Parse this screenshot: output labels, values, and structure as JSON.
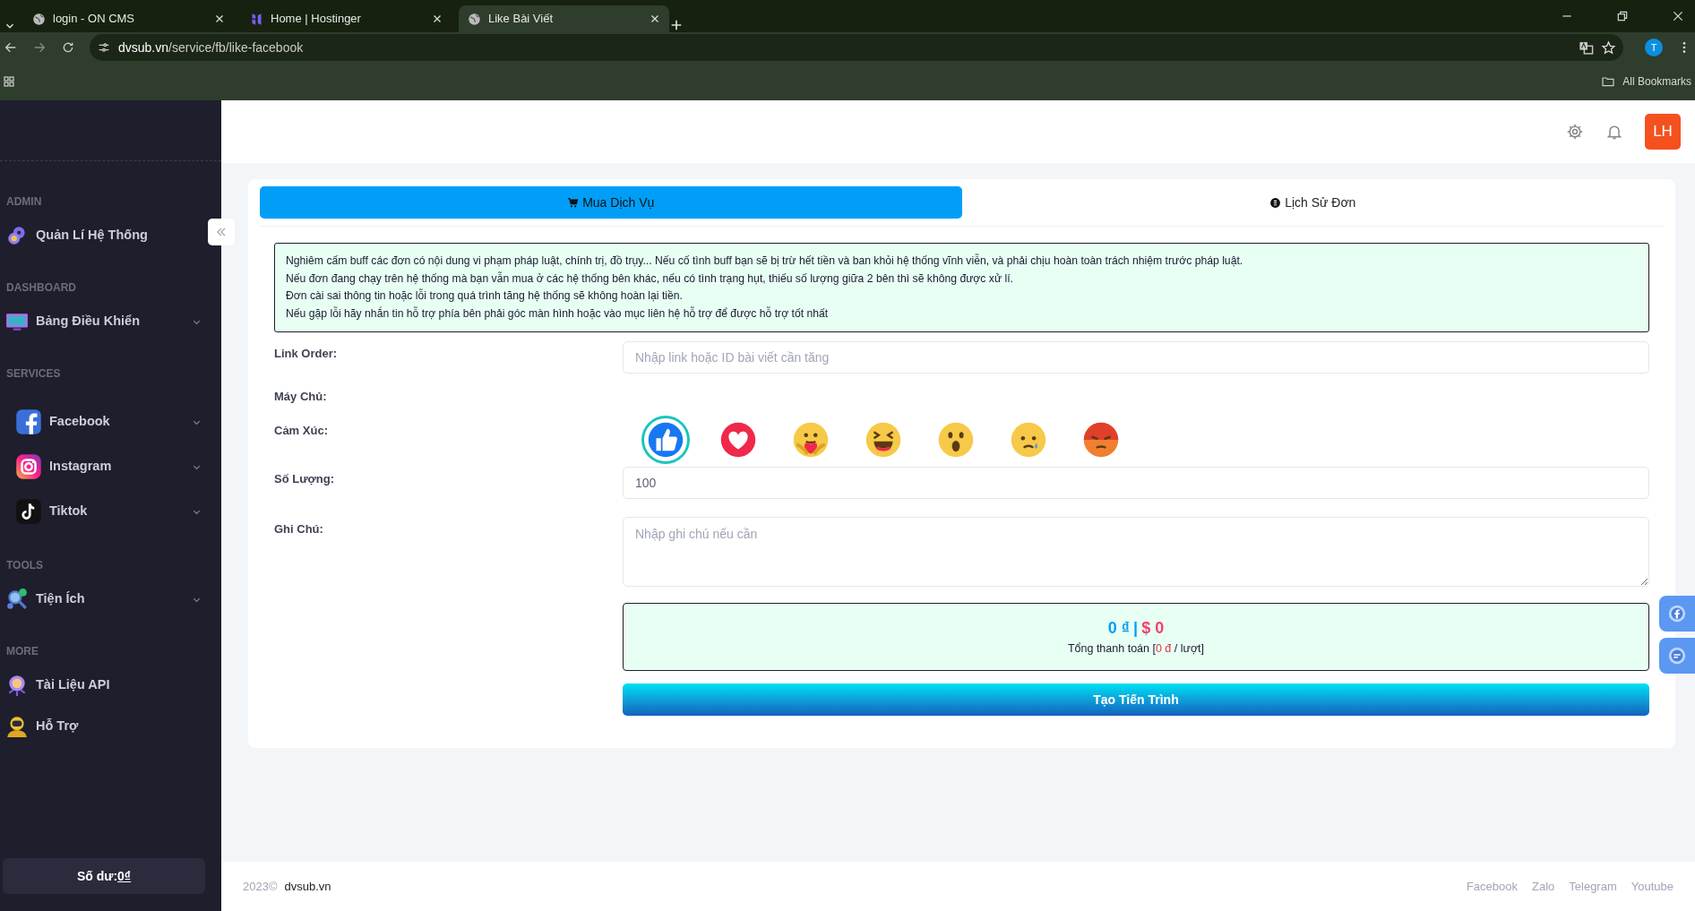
{
  "browser": {
    "tabs": [
      {
        "title": "login - ON CMS",
        "selected": false
      },
      {
        "title": "Home | Hostinger",
        "selected": false
      },
      {
        "title": "Like Bài Viết",
        "selected": true
      }
    ],
    "url_host": "dvsub.vn",
    "url_path": "/service/fb/like-facebook",
    "profile": "T",
    "bookmarks": "All Bookmarks"
  },
  "sidebar": {
    "items": [
      {
        "kind": "section",
        "label": "ADMIN"
      },
      {
        "kind": "item",
        "label": "Quản Lí Hệ Thống",
        "expandable": false
      },
      {
        "kind": "section",
        "label": "DASHBOARD"
      },
      {
        "kind": "item",
        "label": "Bảng Điều Khiển",
        "expandable": true
      },
      {
        "kind": "section",
        "label": "SERVICES"
      },
      {
        "kind": "item",
        "label": "Facebook",
        "expandable": true
      },
      {
        "kind": "item",
        "label": "Instagram",
        "expandable": true
      },
      {
        "kind": "item",
        "label": "Tiktok",
        "expandable": true
      },
      {
        "kind": "section",
        "label": "TOOLS"
      },
      {
        "kind": "item",
        "label": "Tiện Ích",
        "expandable": true
      },
      {
        "kind": "section",
        "label": "MORE"
      },
      {
        "kind": "item",
        "label": "Tài Liệu API",
        "expandable": false
      },
      {
        "kind": "item",
        "label": "Hỗ Trợ",
        "expandable": false
      }
    ],
    "balance_label": "Số dư: ",
    "balance_value": "0₫"
  },
  "header": {
    "avatar": "LH"
  },
  "tabs": [
    {
      "label": "Mua Dịch Vụ",
      "selected": true
    },
    {
      "label": "Lịch Sử Đơn",
      "selected": false
    }
  ],
  "notice": [
    "Nghiêm cấm buff các đơn có nội dung vi phạm pháp luật, chính trị, đồ trụy... Nếu cố tình buff bạn sẽ bị trừ hết tiền và ban khỏi hệ thống vĩnh viễn, và phải chịu hoàn toàn trách nhiệm trước pháp luật.",
    "Nếu đơn đang chạy trên hệ thống mà bạn vẫn mua ở các hệ thống bên khác, nếu có tình trạng hụt, thiếu số lượng giữa 2 bên thì sẽ không được xử lí.",
    "Đơn cài sai thông tin hoặc lỗi trong quá trình tăng hệ thống sẽ không hoàn lại tiền.",
    "Nếu gặp lỗi hãy nhắn tin hỗ trợ phía bên phải góc màn hình hoặc vào mục liên hệ hỗ trợ để được hỗ trợ tốt nhất"
  ],
  "form": {
    "link_label": "Link Order:",
    "link_placeholder": "Nhập link hoặc ID bài viết cần tăng",
    "server_label": "Máy Chủ:",
    "reaction_label": "Cảm Xúc:",
    "reactions": [
      {
        "kind": "like",
        "selected": true
      },
      {
        "kind": "love",
        "selected": false
      },
      {
        "kind": "care",
        "selected": false
      },
      {
        "kind": "haha",
        "selected": false
      },
      {
        "kind": "wow",
        "selected": false
      },
      {
        "kind": "sad",
        "selected": false
      },
      {
        "kind": "angry",
        "selected": false
      }
    ],
    "quantity_label": "Số Lượng:",
    "quantity_value": "100",
    "note_label": "Ghi Chú:",
    "note_placeholder": "Nhập ghi chú nếu cần"
  },
  "total": {
    "vnd": "0 ₫",
    "separator": "|",
    "usd": "$ 0",
    "caption_before": "Tổng thanh toán [",
    "unit_price": "0 đ",
    "caption_after": " / lượt]"
  },
  "submit": "Tạo Tiến Trình",
  "footer": {
    "copyright": "2023©",
    "site": "dvsub.vn",
    "links": [
      "Facebook",
      "Zalo",
      "Telegram",
      "Youtube"
    ]
  }
}
